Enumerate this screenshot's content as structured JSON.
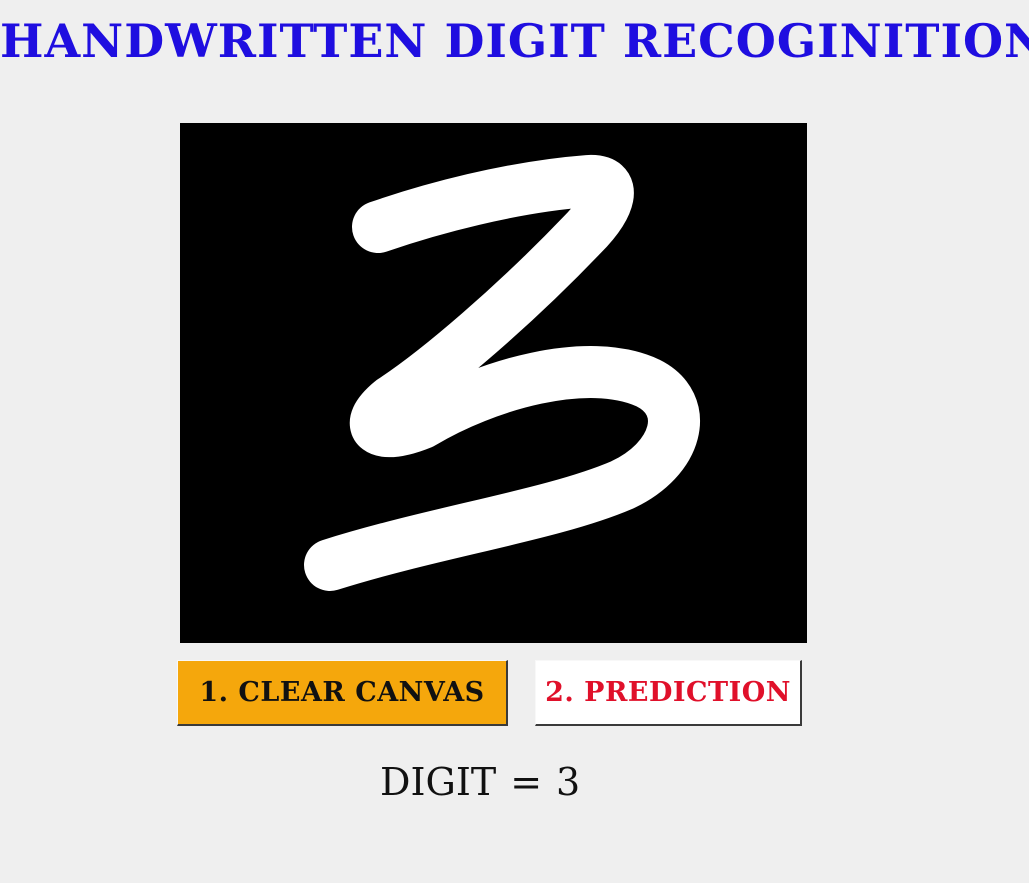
{
  "app": {
    "title": "HANDWRITTEN DIGIT RECOGINITION"
  },
  "canvas": {
    "background": "#000000",
    "stroke_color": "#ffffff",
    "drawn_digit": "3"
  },
  "buttons": {
    "clear_label": "1. CLEAR CANVAS",
    "clear_color": "#f5a70c",
    "predict_label": "2. PREDICTION",
    "predict_color": "#e0102a"
  },
  "result": {
    "label": "DIGIT",
    "separator": "=",
    "value": "3"
  },
  "colors": {
    "title": "#1f0ee0",
    "window_background": "#efefef"
  }
}
